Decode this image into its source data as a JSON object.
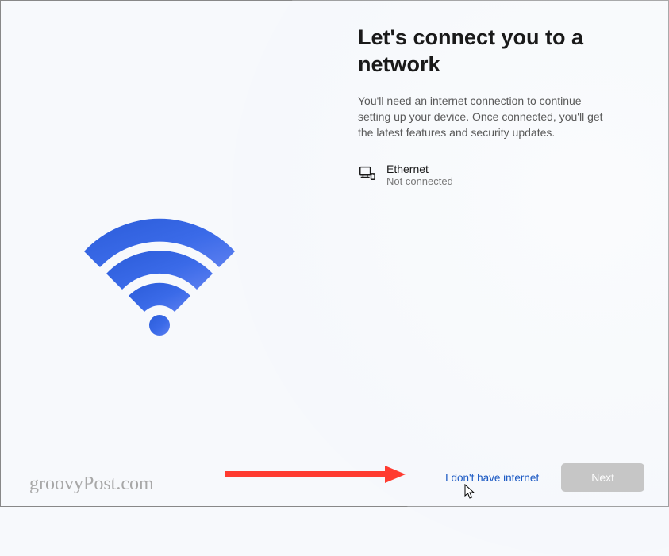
{
  "header": {
    "title": "Let's connect you to a network",
    "description": "You'll need an internet connection to continue setting up your device. Once connected, you'll get the latest features and security updates."
  },
  "network": {
    "name": "Ethernet",
    "status": "Not connected"
  },
  "footer": {
    "skip_label": "I don't have internet",
    "next_label": "Next"
  },
  "watermark": "groovyPost.com"
}
